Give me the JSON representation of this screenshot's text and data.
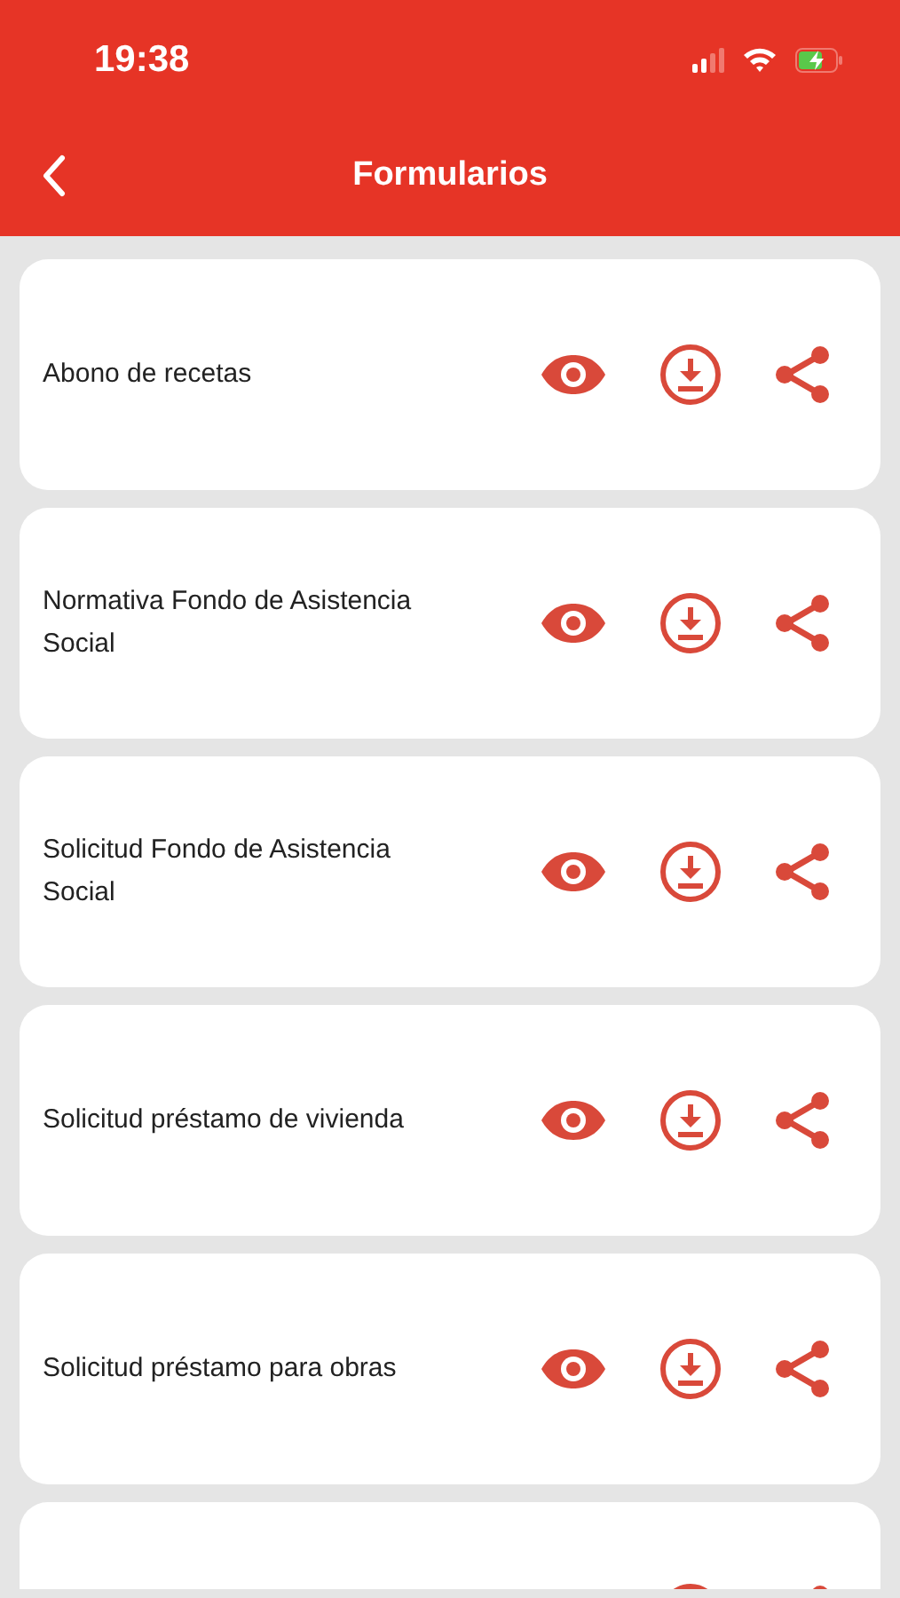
{
  "status_bar": {
    "time": "19:38"
  },
  "header": {
    "title": "Formularios"
  },
  "forms": [
    {
      "title": "Abono de recetas"
    },
    {
      "title": "Normativa Fondo de Asistencia Social"
    },
    {
      "title": "Solicitud Fondo de Asistencia Social"
    },
    {
      "title": "Solicitud préstamo de vivienda"
    },
    {
      "title": "Solicitud préstamo para obras"
    }
  ],
  "more_below": true
}
